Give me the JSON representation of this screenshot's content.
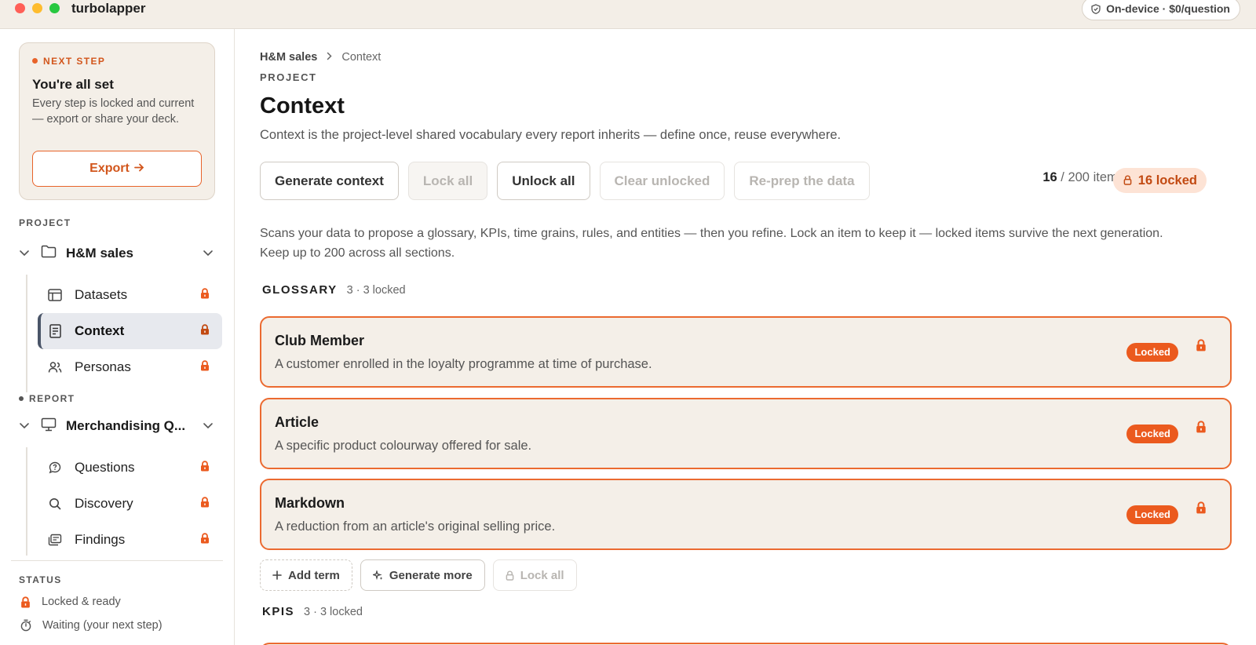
{
  "app": {
    "name": "turbolapper",
    "badge": "On-device · $0/question"
  },
  "next_step": {
    "label": "NEXT STEP",
    "title": "You're all set",
    "description": "Every step is locked and current — export or share your deck.",
    "button": "Export"
  },
  "sidebar": {
    "project_label": "PROJECT",
    "project_name": "H&M sales",
    "project_items": [
      {
        "label": "Datasets",
        "icon": "table-icon"
      },
      {
        "label": "Context",
        "icon": "document-icon",
        "active": true
      },
      {
        "label": "Personas",
        "icon": "users-icon"
      }
    ],
    "report_label": "REPORT",
    "report_name": "Merchandising Q...",
    "report_items": [
      {
        "label": "Questions",
        "icon": "chat-question-icon"
      },
      {
        "label": "Discovery",
        "icon": "search-icon"
      },
      {
        "label": "Findings",
        "icon": "cards-icon"
      }
    ],
    "status_label": "STATUS",
    "status_items": [
      {
        "label": "Locked & ready",
        "icon": "lock-icon"
      },
      {
        "label": "Waiting (your next step)",
        "icon": "timer-icon"
      }
    ]
  },
  "main": {
    "breadcrumb": [
      "H&M sales",
      "Context"
    ],
    "eyebrow": "PROJECT",
    "title": "Context",
    "subtitle": "Context is the project-level shared vocabulary every report inherits — define once, reuse everywhere.",
    "toolbar": {
      "generate": "Generate context",
      "lock_all": "Lock all",
      "unlock_all": "Unlock all",
      "clear_unlocked": "Clear unlocked",
      "reprep": "Re-prep the data"
    },
    "count_current": "16",
    "count_total": " / 200 items",
    "locked_pill": "16 locked",
    "intro": "Scans your data to propose a glossary, KPIs, time grains, rules, and entities — then you refine. Lock an item to keep it — locked items survive the next generation. Keep up to 200 across all sections.",
    "glossary": {
      "title": "GLOSSARY",
      "meta": "3 · 3 locked",
      "items": [
        {
          "name": "Club Member",
          "desc": "A customer enrolled in the loyalty programme at time of purchase.",
          "badge": "Locked"
        },
        {
          "name": "Article",
          "desc": "A specific product colourway offered for sale.",
          "badge": "Locked"
        },
        {
          "name": "Markdown",
          "desc": "A reduction from an article's original selling price.",
          "badge": "Locked"
        }
      ],
      "actions": {
        "add": "Add term",
        "generate": "Generate more",
        "lock_all": "Lock all"
      }
    },
    "kpis": {
      "title": "KPIS",
      "meta": "3 · 3 locked"
    }
  },
  "colors": {
    "accent": "#eb6a30",
    "card_bg": "#f4efe8",
    "active_nav": "#e7e9ee"
  }
}
